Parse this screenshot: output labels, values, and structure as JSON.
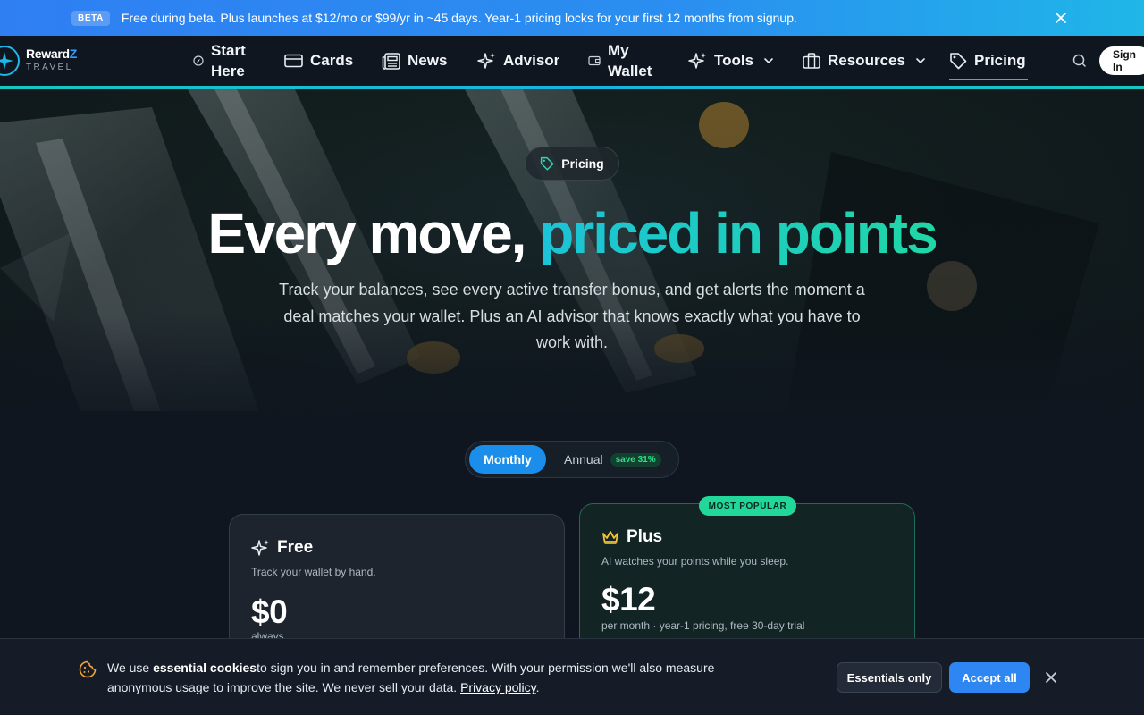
{
  "banner": {
    "badge": "BETA",
    "text": "Free during beta. Plus launches at $12/mo or $99/yr in ~45 days. Year-1 pricing locks for your first 12 months from signup."
  },
  "brand": {
    "name_main": "Reward",
    "name_accent": "Z",
    "sub": "TRAVEL"
  },
  "nav": {
    "start_line1": "Start",
    "start_line2": "Here",
    "cards": "Cards",
    "news": "News",
    "advisor": "Advisor",
    "wallet_line1": "My",
    "wallet_line2": "Wallet",
    "tools": "Tools",
    "resources": "Resources",
    "pricing": "Pricing",
    "signin_line1": "Sign",
    "signin_line2": "In"
  },
  "hero": {
    "pill": "Pricing",
    "headline_plain": "Every move, ",
    "headline_accent": "priced in points",
    "subtitle": "Track your balances, see every active transfer bonus, and get alerts the moment a deal matches your wallet. Plus an AI advisor that knows exactly what you have to work with."
  },
  "billing_toggle": {
    "monthly": "Monthly",
    "annual": "Annual",
    "save_badge": "save 31%",
    "selected": "Monthly"
  },
  "plans": {
    "free": {
      "name": "Free",
      "description": "Track your wallet by hand.",
      "price": "$0",
      "note": "always"
    },
    "plus": {
      "badge": "MOST POPULAR",
      "name": "Plus",
      "description": "AI watches your points while you sleep.",
      "price": "$12",
      "note": "per month · year-1 pricing, free 30-day trial"
    }
  },
  "cookie": {
    "text_before": "We use ",
    "text_bold": "essential cookies",
    "text_after": "to sign you in and remember preferences. With your permission we'll also measure anonymous usage to improve the site. We never sell your data. ",
    "link": "Privacy policy",
    "period": ".",
    "essentials_button": "Essentials only",
    "accept_button": "Accept all"
  },
  "colors": {
    "accent_teal": "#19c9c0",
    "primary_blue": "#2d86f2",
    "popular_green": "#22d79a",
    "background": "#0f1620"
  }
}
